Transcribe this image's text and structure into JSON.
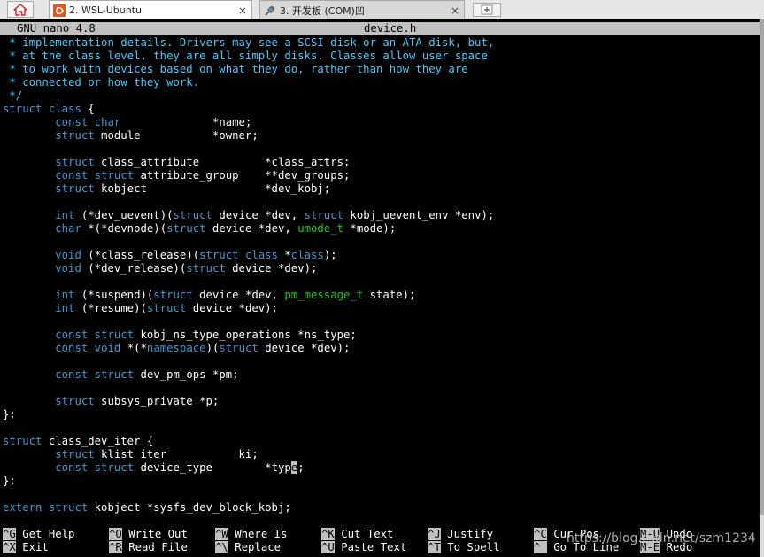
{
  "tabs": [
    {
      "label": "2. WSL-Ubuntu",
      "close": "×",
      "active": true,
      "icon": "ubuntu-icon"
    },
    {
      "label": "3. 开发板 (COM)凹",
      "close": "×",
      "active": false,
      "icon": "serial-plug-icon"
    }
  ],
  "nano": {
    "version": "GNU nano 4.8",
    "filename": "device.h"
  },
  "colors": {
    "comment": "#44ccff",
    "keyword": "#3a9bd6",
    "type": "#22c322",
    "text": "#ffffff",
    "bar": "#c0c0c0"
  },
  "code": [
    [
      [
        "c",
        " * implementation details. Drivers may see a SCSI disk or an ATA disk, but,"
      ]
    ],
    [
      [
        "c",
        " * at the class level, they are all simply disks. Classes allow user space"
      ]
    ],
    [
      [
        "c",
        " * to work with devices based on what they do, rather than how they are"
      ]
    ],
    [
      [
        "c",
        " * connected or how they work."
      ]
    ],
    [
      [
        "c",
        " */"
      ]
    ],
    [
      [
        "k",
        "struct"
      ],
      [
        "w",
        " "
      ],
      [
        "k",
        "class"
      ],
      [
        "w",
        " {"
      ]
    ],
    [
      [
        "w",
        "        "
      ],
      [
        "k",
        "const"
      ],
      [
        "w",
        " "
      ],
      [
        "k",
        "char"
      ],
      [
        "w",
        "              *name;"
      ]
    ],
    [
      [
        "w",
        "        "
      ],
      [
        "k",
        "struct"
      ],
      [
        "w",
        " module           *owner;"
      ]
    ],
    [
      [
        "w",
        ""
      ]
    ],
    [
      [
        "w",
        "        "
      ],
      [
        "k",
        "struct"
      ],
      [
        "w",
        " class_attribute          *class_attrs;"
      ]
    ],
    [
      [
        "w",
        "        "
      ],
      [
        "k",
        "const"
      ],
      [
        "w",
        " "
      ],
      [
        "k",
        "struct"
      ],
      [
        "w",
        " attribute_group    **dev_groups;"
      ]
    ],
    [
      [
        "w",
        "        "
      ],
      [
        "k",
        "struct"
      ],
      [
        "w",
        " kobject                  *dev_kobj;"
      ]
    ],
    [
      [
        "w",
        ""
      ]
    ],
    [
      [
        "w",
        "        "
      ],
      [
        "k",
        "int"
      ],
      [
        "w",
        " (*dev_uevent)("
      ],
      [
        "k",
        "struct"
      ],
      [
        "w",
        " device *dev, "
      ],
      [
        "k",
        "struct"
      ],
      [
        "w",
        " kobj_uevent_env *env);"
      ]
    ],
    [
      [
        "w",
        "        "
      ],
      [
        "k",
        "char"
      ],
      [
        "w",
        " *(*devnode)("
      ],
      [
        "k",
        "struct"
      ],
      [
        "w",
        " device *dev, "
      ],
      [
        "t",
        "umode_t"
      ],
      [
        "w",
        " *mode);"
      ]
    ],
    [
      [
        "w",
        ""
      ]
    ],
    [
      [
        "w",
        "        "
      ],
      [
        "k",
        "void"
      ],
      [
        "w",
        " (*class_release)("
      ],
      [
        "k",
        "struct"
      ],
      [
        "w",
        " "
      ],
      [
        "k",
        "class"
      ],
      [
        "w",
        " *"
      ],
      [
        "k",
        "class"
      ],
      [
        "w",
        ");"
      ]
    ],
    [
      [
        "w",
        "        "
      ],
      [
        "k",
        "void"
      ],
      [
        "w",
        " (*dev_release)("
      ],
      [
        "k",
        "struct"
      ],
      [
        "w",
        " device *dev);"
      ]
    ],
    [
      [
        "w",
        ""
      ]
    ],
    [
      [
        "w",
        "        "
      ],
      [
        "k",
        "int"
      ],
      [
        "w",
        " (*suspend)("
      ],
      [
        "k",
        "struct"
      ],
      [
        "w",
        " device *dev, "
      ],
      [
        "t",
        "pm_message_t"
      ],
      [
        "w",
        " state);"
      ]
    ],
    [
      [
        "w",
        "        "
      ],
      [
        "k",
        "int"
      ],
      [
        "w",
        " (*resume)("
      ],
      [
        "k",
        "struct"
      ],
      [
        "w",
        " device *dev);"
      ]
    ],
    [
      [
        "w",
        ""
      ]
    ],
    [
      [
        "w",
        "        "
      ],
      [
        "k",
        "const"
      ],
      [
        "w",
        " "
      ],
      [
        "k",
        "struct"
      ],
      [
        "w",
        " kobj_ns_type_operations *ns_type;"
      ]
    ],
    [
      [
        "w",
        "        "
      ],
      [
        "k",
        "const"
      ],
      [
        "w",
        " "
      ],
      [
        "k",
        "void"
      ],
      [
        "w",
        " *(*"
      ],
      [
        "k",
        "namespace"
      ],
      [
        "w",
        ")("
      ],
      [
        "k",
        "struct"
      ],
      [
        "w",
        " device *dev);"
      ]
    ],
    [
      [
        "w",
        ""
      ]
    ],
    [
      [
        "w",
        "        "
      ],
      [
        "k",
        "const"
      ],
      [
        "w",
        " "
      ],
      [
        "k",
        "struct"
      ],
      [
        "w",
        " dev_pm_ops *pm;"
      ]
    ],
    [
      [
        "w",
        ""
      ]
    ],
    [
      [
        "w",
        "        "
      ],
      [
        "k",
        "struct"
      ],
      [
        "w",
        " subsys_private *p;"
      ]
    ],
    [
      [
        "w",
        "};"
      ]
    ],
    [
      [
        "w",
        ""
      ]
    ],
    [
      [
        "k",
        "struct"
      ],
      [
        "w",
        " class_dev_iter {"
      ]
    ],
    [
      [
        "w",
        "        "
      ],
      [
        "k",
        "struct"
      ],
      [
        "w",
        " klist_iter           ki;"
      ]
    ],
    [
      [
        "w",
        "        "
      ],
      [
        "k",
        "const"
      ],
      [
        "w",
        " "
      ],
      [
        "k",
        "struct"
      ],
      [
        "w",
        " device_type        *typ"
      ],
      [
        "cur",
        "e"
      ],
      [
        "w",
        ";"
      ]
    ],
    [
      [
        "w",
        "};"
      ]
    ],
    [
      [
        "w",
        ""
      ]
    ],
    [
      [
        "k",
        "extern"
      ],
      [
        "w",
        " "
      ],
      [
        "k",
        "struct"
      ],
      [
        "w",
        " kobject *sysfs_dev_block_kobj;"
      ]
    ]
  ],
  "shortcuts": [
    {
      "key": "^G",
      "label": "Get Help"
    },
    {
      "key": "^X",
      "label": "Exit"
    },
    {
      "key": "^O",
      "label": "Write Out"
    },
    {
      "key": "^R",
      "label": "Read File"
    },
    {
      "key": "^W",
      "label": "Where Is"
    },
    {
      "key": "^\\",
      "label": "Replace"
    },
    {
      "key": "^K",
      "label": "Cut Text"
    },
    {
      "key": "^U",
      "label": "Paste Text"
    },
    {
      "key": "^J",
      "label": "Justify"
    },
    {
      "key": "^T",
      "label": "To Spell"
    },
    {
      "key": "^C",
      "label": "Cur Pos"
    },
    {
      "key": "^_",
      "label": "Go To Line"
    },
    {
      "key": "M-U",
      "label": "Undo"
    },
    {
      "key": "M-E",
      "label": "Redo"
    }
  ],
  "watermark": "https://blog.csdn.net/szm1234"
}
